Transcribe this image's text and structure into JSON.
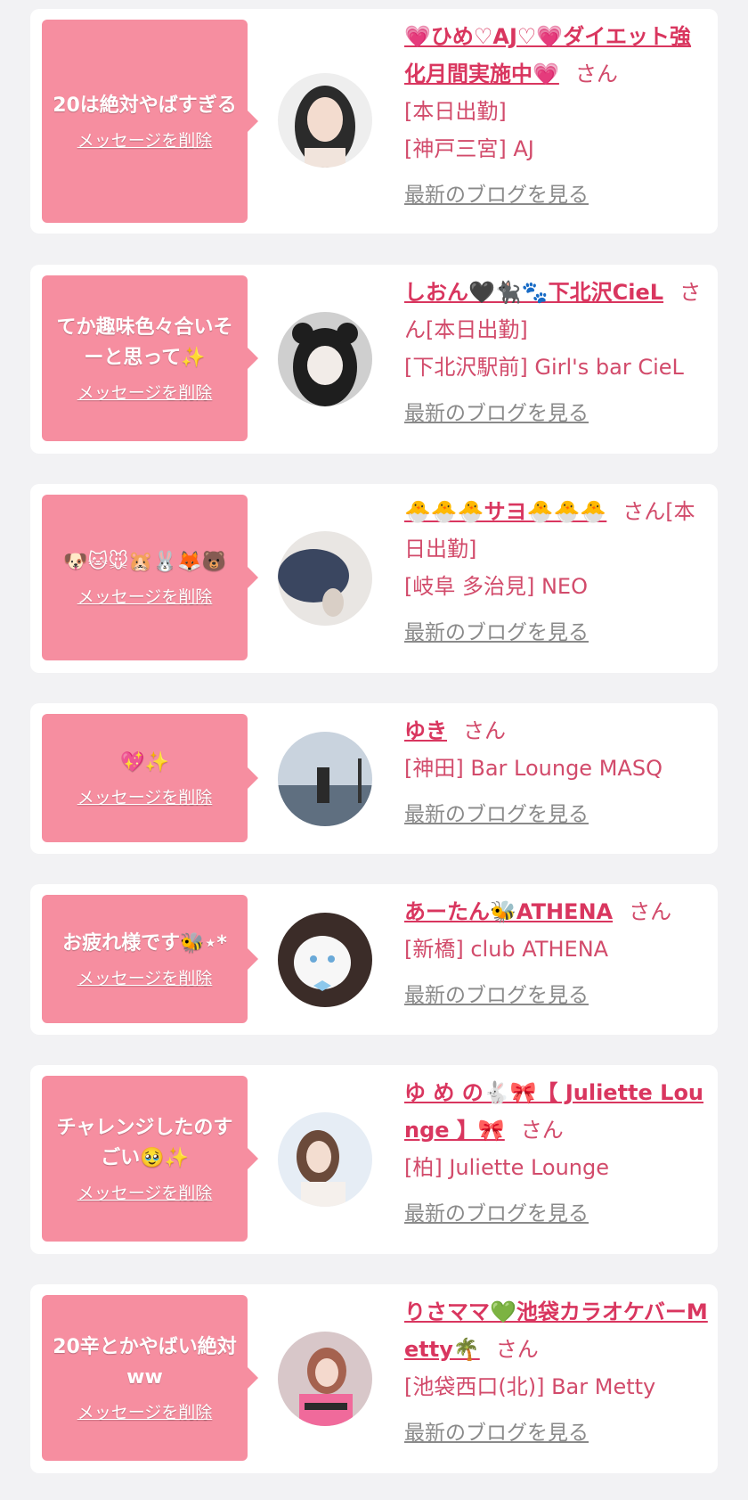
{
  "accent": "#f68ea0",
  "name_color": "#d9365f",
  "text_color": "#d24b6b",
  "link_gray": "#8a8a8a",
  "delete_label": "メッセージを削除",
  "blog_label": "最新のブログを見る",
  "san_label": "さん",
  "items": [
    {
      "message": "20は絶対やばすぎる",
      "name": "💗ひめ♡AJ♡💗ダイエット強化月間実施中💗",
      "lines": [
        "[本日出勤]",
        "[神戸三宮] AJ"
      ]
    },
    {
      "message": "てか趣味色々合いそーと思って✨",
      "name": "しおん🖤🐈‍⬛🐾下北沢CieL",
      "lines": [
        "[本日出勤]",
        "[下北沢駅前] Girl's bar CieL"
      ]
    },
    {
      "message": "🐶🐱🐭🐹🐰🦊🐻",
      "name": "🐣🐣🐣サヨ🐣🐣🐣",
      "lines": [
        "[本日出勤]",
        "[岐阜 多治見] NEO"
      ]
    },
    {
      "message": "💖✨",
      "name": "ゆき",
      "lines": [
        "[神田] Bar Lounge MASQ"
      ]
    },
    {
      "message": "お疲れ様です🐝⋆*",
      "name": "あーたん🐝ATHENA",
      "lines": [
        "[新橋] club ATHENA"
      ]
    },
    {
      "message": "チャレンジしたのすごい🥹✨",
      "name": "ゆ め の🐇🎀【 Juliette Lounge 】🎀",
      "lines": [
        "[柏] Juliette Lounge"
      ]
    },
    {
      "message": "20辛とかやばい絶対ww",
      "name": "りさママ💚池袋カラオケバーMetty🌴",
      "lines": [
        "[池袋西口(北)] Bar Metty"
      ]
    }
  ]
}
